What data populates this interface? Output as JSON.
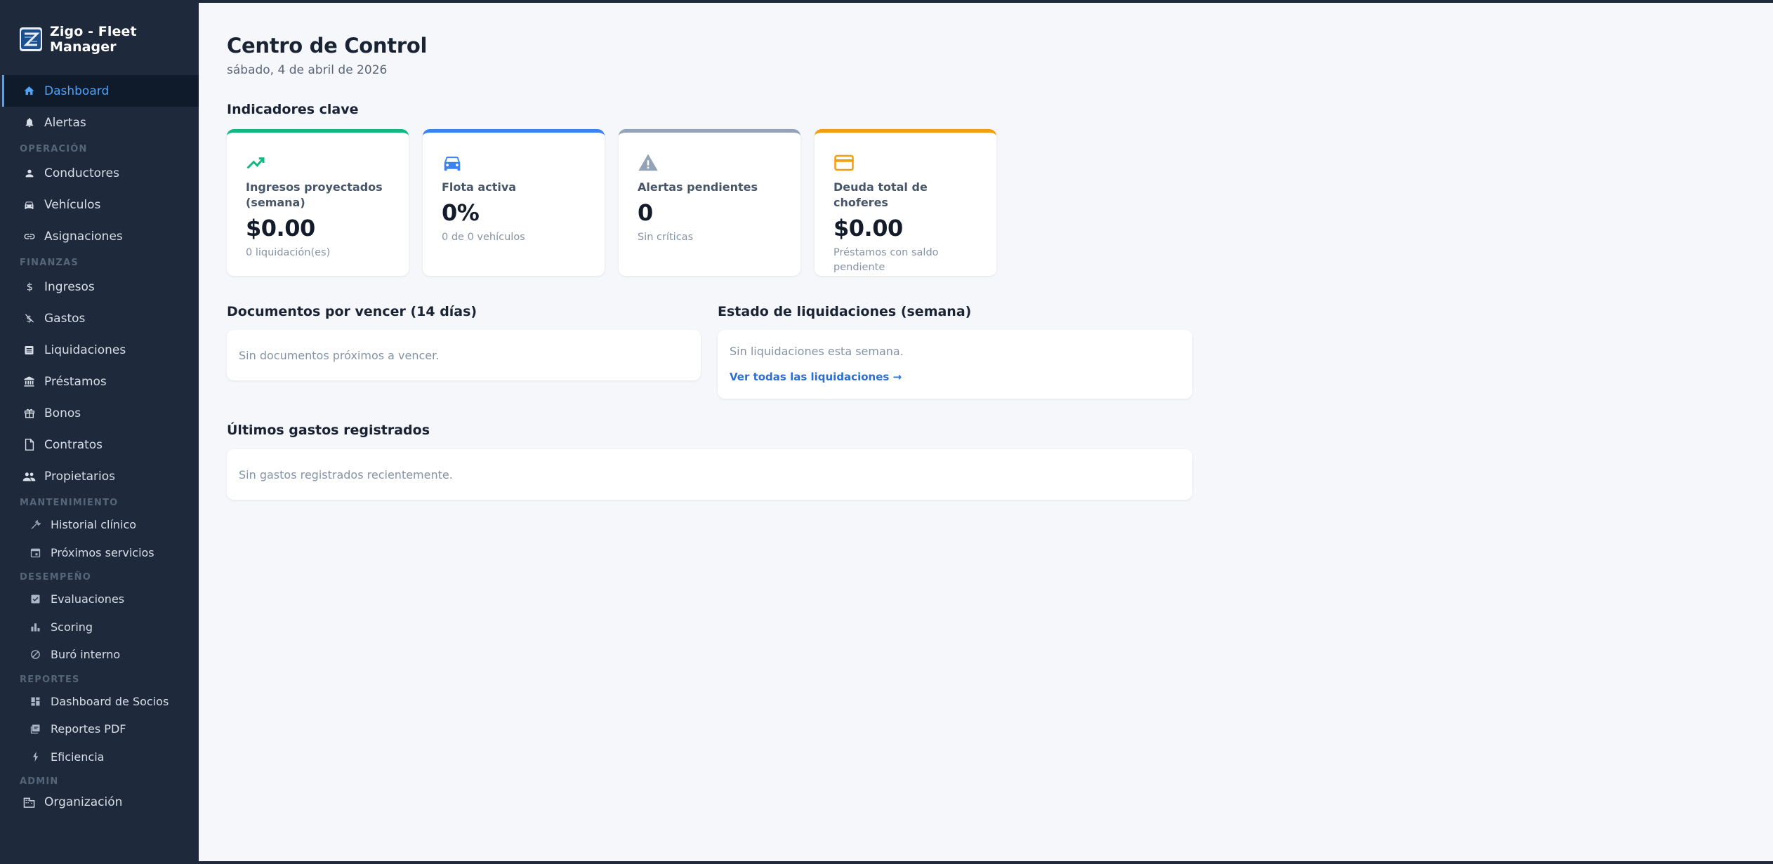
{
  "app": {
    "title": "Zigo - Fleet Manager"
  },
  "sidebar": {
    "top": [
      {
        "label": "Dashboard",
        "icon": "home-icon",
        "active": true
      },
      {
        "label": "Alertas",
        "icon": "bell-icon"
      }
    ],
    "sections": [
      {
        "label": "OPERACIÓN",
        "items": [
          {
            "label": "Conductores",
            "icon": "person-icon"
          },
          {
            "label": "Vehículos",
            "icon": "car-icon"
          },
          {
            "label": "Asignaciones",
            "icon": "link-icon"
          }
        ]
      },
      {
        "label": "FINANZAS",
        "items": [
          {
            "label": "Ingresos",
            "icon": "dollar-icon"
          },
          {
            "label": "Gastos",
            "icon": "money-off-icon"
          },
          {
            "label": "Liquidaciones",
            "icon": "list-icon"
          },
          {
            "label": "Préstamos",
            "icon": "bank-icon"
          },
          {
            "label": "Bonos",
            "icon": "gift-icon"
          },
          {
            "label": "Contratos",
            "icon": "document-icon"
          },
          {
            "label": "Propietarios",
            "icon": "people-icon"
          }
        ]
      },
      {
        "label": "MANTENIMIENTO",
        "items": [
          {
            "label": "Historial clínico",
            "icon": "wrench-icon"
          },
          {
            "label": "Próximos servicios",
            "icon": "calendar-icon"
          }
        ]
      },
      {
        "label": "DESEMPEÑO",
        "items": [
          {
            "label": "Evaluaciones",
            "icon": "checkbox-icon"
          },
          {
            "label": "Scoring",
            "icon": "bar-chart-icon"
          },
          {
            "label": "Buró interno",
            "icon": "block-icon"
          }
        ]
      },
      {
        "label": "REPORTES",
        "items": [
          {
            "label": "Dashboard de Socios",
            "icon": "grid-icon"
          },
          {
            "label": "Reportes PDF",
            "icon": "pdf-icon"
          },
          {
            "label": "Eficiencia",
            "icon": "bolt-icon"
          }
        ]
      },
      {
        "label": "ADMIN",
        "items": [
          {
            "label": "Organización",
            "icon": "building-icon"
          }
        ]
      }
    ]
  },
  "header": {
    "title": "Centro de Control",
    "date": "sábado, 4 de abril de 2026"
  },
  "kpis": {
    "heading": "Indicadores clave",
    "cards": [
      {
        "label": "Ingresos proyectados (semana)",
        "value": "$0.00",
        "sub": "0 liquidación(es)",
        "icon": "trending-up-icon",
        "color": "#10b981"
      },
      {
        "label": "Flota activa",
        "value": "0%",
        "sub": "0 de 0 vehículos",
        "icon": "car-icon",
        "color": "#3b82f6"
      },
      {
        "label": "Alertas pendientes",
        "value": "0",
        "sub": "Sin críticas",
        "icon": "warning-icon",
        "color": "#94a3b8"
      },
      {
        "label": "Deuda total de choferes",
        "value": "$0.00",
        "sub": "Préstamos con saldo pendiente",
        "icon": "credit-card-icon",
        "color": "#f59e0b"
      }
    ]
  },
  "documents": {
    "heading": "Documentos por vencer (14 días)",
    "empty": "Sin documentos próximos a vencer."
  },
  "settlements": {
    "heading": "Estado de liquidaciones (semana)",
    "empty": "Sin liquidaciones esta semana.",
    "link": "Ver todas las liquidaciones →"
  },
  "expenses": {
    "heading": "Últimos gastos registrados",
    "empty": "Sin gastos registrados recientemente."
  }
}
